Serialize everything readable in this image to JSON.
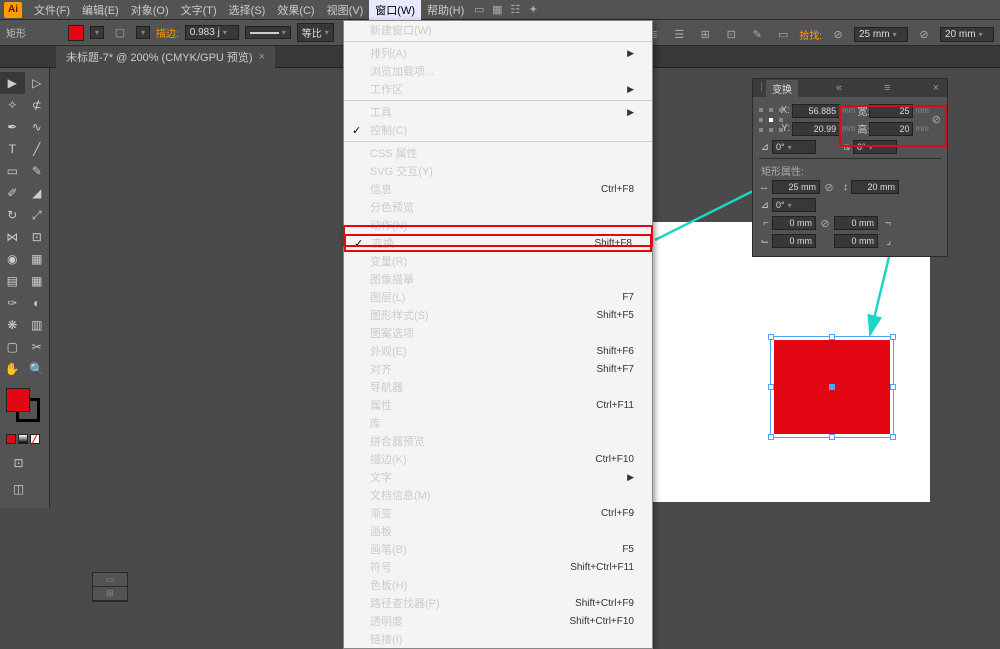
{
  "app": {
    "logo": "Ai"
  },
  "menubar": {
    "items": [
      "文件(F)",
      "编辑(E)",
      "对象(O)",
      "文字(T)",
      "选择(S)",
      "效果(C)",
      "视图(V)",
      "窗口(W)",
      "帮助(H)"
    ],
    "open_index": 7
  },
  "ctrlbar": {
    "shape": "矩形",
    "opacity_label": "描边:",
    "opacity": "0.983  j",
    "preset": "等比",
    "fixbtn": "拾找:",
    "w": "25 mm",
    "h": "20 mm"
  },
  "doc": {
    "tab": "未标题-7* @ 200% (CMYK/GPU 预览)"
  },
  "dropdown": {
    "groups": [
      [
        {
          "l": "新建窗口(W)"
        }
      ],
      [
        {
          "l": "排列(A)",
          "sub": true
        },
        {
          "l": "浏览加载项..."
        },
        {
          "l": "工作区",
          "sub": true
        }
      ],
      [
        {
          "l": "工具",
          "sub": true
        },
        {
          "l": "控制(C)",
          "chk": true
        }
      ],
      [
        {
          "l": "CSS 属性"
        },
        {
          "l": "SVG 交互(Y)"
        },
        {
          "l": "信息",
          "sc": "Ctrl+F8"
        },
        {
          "l": "分色预览"
        },
        {
          "l": "动作(N)"
        },
        {
          "l": "变换",
          "sc": "Shift+F8",
          "chk": true,
          "hl": true
        },
        {
          "l": "变量(R)"
        },
        {
          "l": "图像描摹"
        },
        {
          "l": "图层(L)",
          "sc": "F7"
        },
        {
          "l": "图形样式(S)",
          "sc": "Shift+F5"
        },
        {
          "l": "图案选项"
        },
        {
          "l": "外观(E)",
          "sc": "Shift+F6"
        },
        {
          "l": "对齐",
          "sc": "Shift+F7"
        },
        {
          "l": "导航器"
        },
        {
          "l": "属性",
          "sc": "Ctrl+F11"
        },
        {
          "l": "库"
        },
        {
          "l": "拼合器预览"
        },
        {
          "l": "描边(K)",
          "sc": "Ctrl+F10"
        },
        {
          "l": "文字",
          "sub": true
        },
        {
          "l": "文档信息(M)"
        },
        {
          "l": "渐变",
          "sc": "Ctrl+F9"
        },
        {
          "l": "画板"
        },
        {
          "l": "画笔(B)",
          "sc": "F5"
        },
        {
          "l": "符号",
          "sc": "Shift+Ctrl+F11"
        },
        {
          "l": "色板(H)"
        },
        {
          "l": "路径查找器(P)",
          "sc": "Shift+Ctrl+F9"
        },
        {
          "l": "透明度",
          "sc": "Shift+Ctrl+F10"
        },
        {
          "l": "链接(I)"
        }
      ]
    ]
  },
  "transform": {
    "title": "变换",
    "x": "56.885",
    "xu": "mm",
    "y": "20.99",
    "yu": "mm",
    "w": "25",
    "wu": "mm",
    "h": "20",
    "hu": "mm",
    "rot": "0°",
    "shear": "0°",
    "sub": "矩形属性:",
    "rw": "25 mm",
    "rh": "20 mm",
    "ra": "0°",
    "c1": "0 mm",
    "c2": "0 mm",
    "c3": "0 mm",
    "c4": "0 mm",
    "xl": "X:",
    "yl": "Y:",
    "wl": "宽:",
    "hl": "高:"
  },
  "chart_data": {
    "type": "table",
    "note": "no chart in image"
  }
}
